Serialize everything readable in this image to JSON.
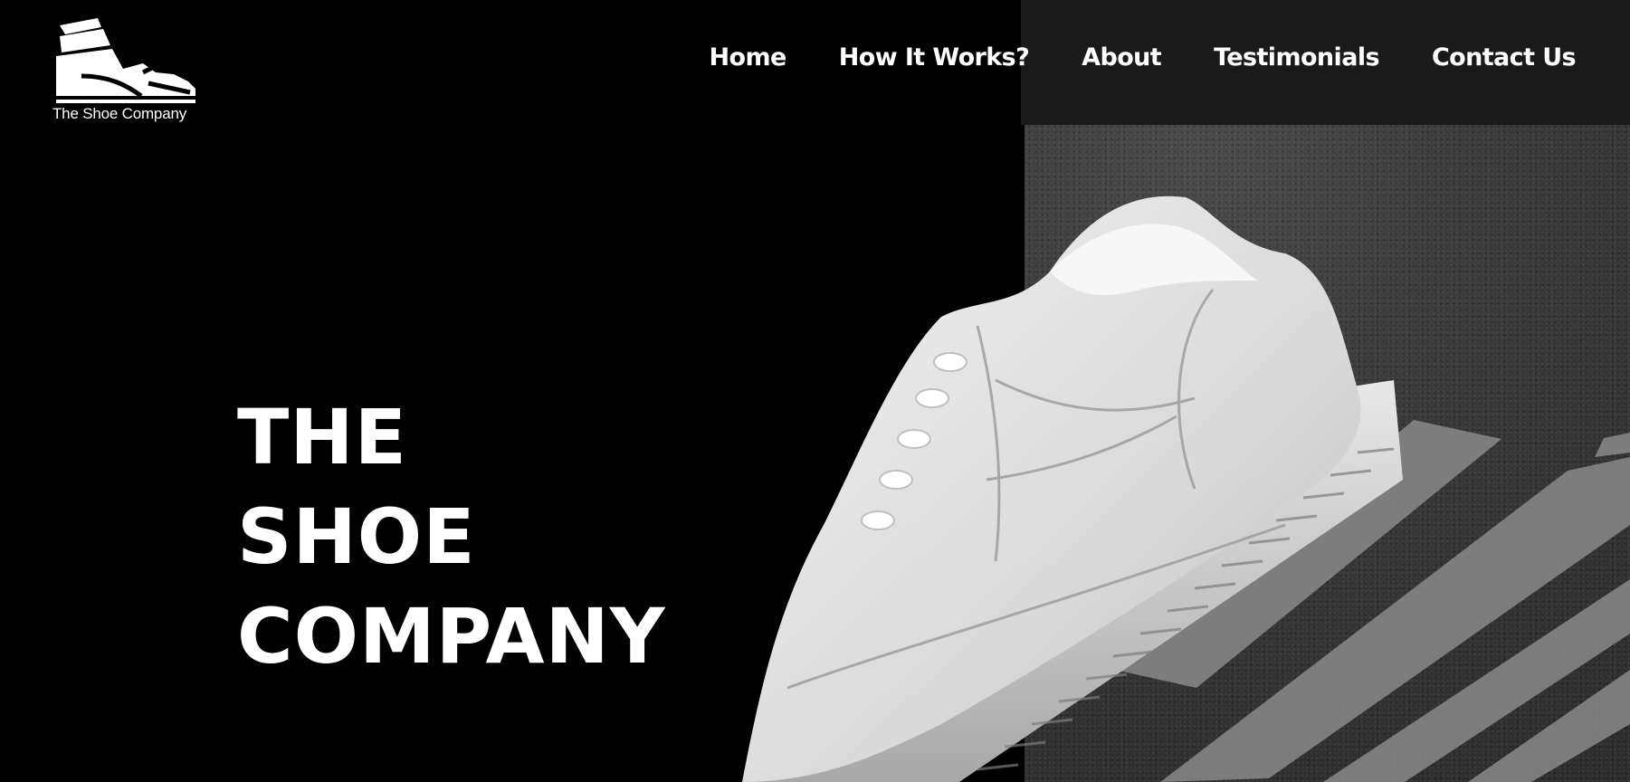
{
  "brand": {
    "logo_icon": "sneaker-icon",
    "name": "The Shoe Company"
  },
  "nav": {
    "items": [
      {
        "label": "Home"
      },
      {
        "label": "How It Works?"
      },
      {
        "label": "About"
      },
      {
        "label": "Testimonials"
      },
      {
        "label": "Contact Us"
      }
    ]
  },
  "hero": {
    "title_lines": [
      "THE",
      "SHOE",
      "COMPANY"
    ],
    "image": "white-sneaker-on-crosswalk"
  },
  "colors": {
    "background": "#000000",
    "text": "#ffffff",
    "header_bar": "#1a1a1a",
    "asphalt": "#3a3a3a"
  }
}
